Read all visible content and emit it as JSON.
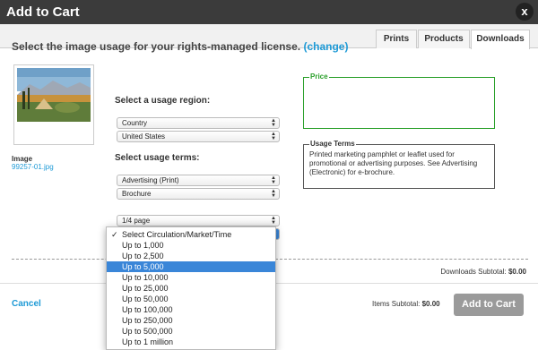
{
  "title": "Add to Cart",
  "close_glyph": "x",
  "tabs": [
    {
      "label": "Prints",
      "active": false
    },
    {
      "label": "Products",
      "active": false
    },
    {
      "label": "Downloads",
      "active": true
    }
  ],
  "heading": {
    "text": "Select the image usage for your rights-managed license.",
    "link": "(change)"
  },
  "image": {
    "label": "Image",
    "file": "99257-01.jpg"
  },
  "region": {
    "label": "Select a usage region:",
    "selects": [
      "Country",
      "United States"
    ]
  },
  "terms": {
    "label": "Select usage terms:",
    "selects": [
      "Advertising (Print)",
      "Brochure",
      "1/4 page"
    ]
  },
  "price": {
    "legend": "Price"
  },
  "usage_terms": {
    "legend": "Usage Terms",
    "body": "Printed marketing pamphlet or leaflet used for promotional or advertising purposes. See Advertising (Electronic) for e-brochure."
  },
  "dropdown": {
    "check_glyph": "✓",
    "options": [
      {
        "label": "Select Circulation/Market/Time",
        "checked": true,
        "highlighted": false
      },
      {
        "label": "Up to 1,000",
        "checked": false,
        "highlighted": false
      },
      {
        "label": "Up to 2,500",
        "checked": false,
        "highlighted": false
      },
      {
        "label": "Up to 5,000",
        "checked": false,
        "highlighted": true
      },
      {
        "label": "Up to 10,000",
        "checked": false,
        "highlighted": false
      },
      {
        "label": "Up to 25,000",
        "checked": false,
        "highlighted": false
      },
      {
        "label": "Up to 50,000",
        "checked": false,
        "highlighted": false
      },
      {
        "label": "Up to 100,000",
        "checked": false,
        "highlighted": false
      },
      {
        "label": "Up to 250,000",
        "checked": false,
        "highlighted": false
      },
      {
        "label": "Up to 500,000",
        "checked": false,
        "highlighted": false
      },
      {
        "label": "Up to 1 million",
        "checked": false,
        "highlighted": false
      }
    ]
  },
  "downloads_subtotal": {
    "label": "Downloads Subtotal:",
    "value": "$0.00"
  },
  "items_subtotal": {
    "label": "Items Subtotal:",
    "value": "$0.00"
  },
  "cancel_label": "Cancel",
  "add_button_label": "Add to Cart",
  "colors": {
    "link": "#1e9ad6",
    "price_border": "#2aa02a",
    "highlight": "#3a86d8",
    "button": "#9a9a9a"
  }
}
